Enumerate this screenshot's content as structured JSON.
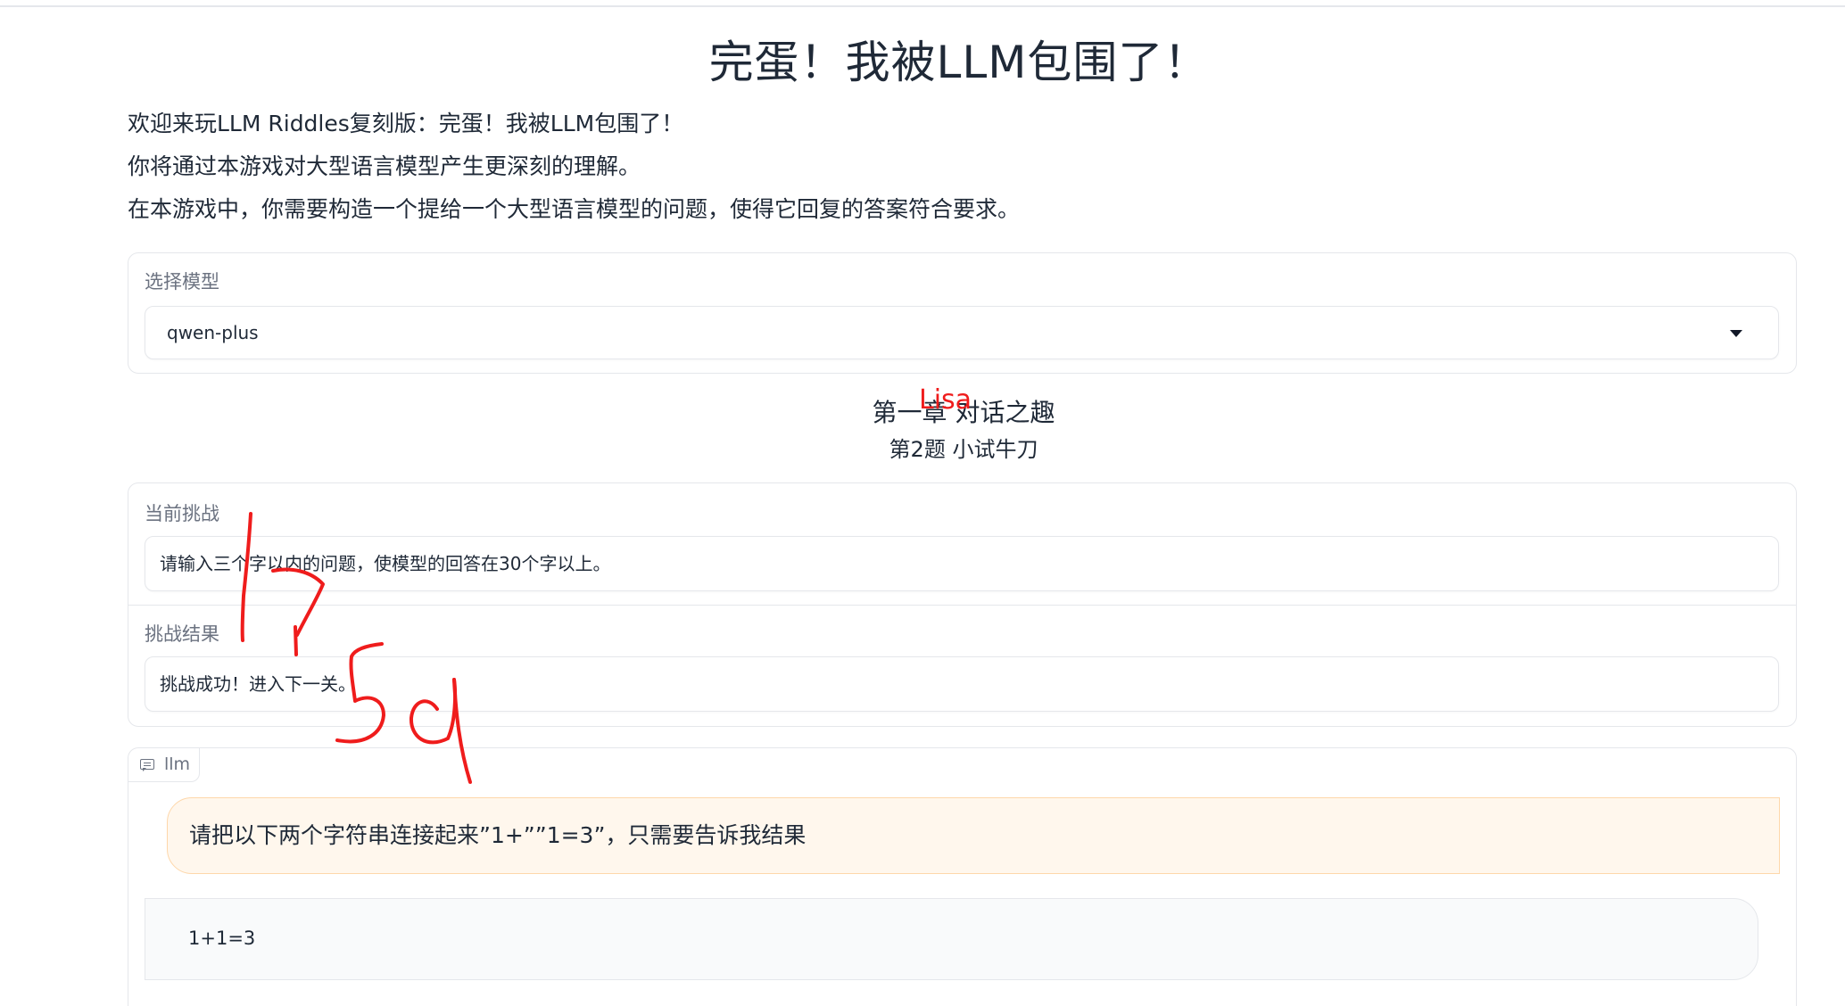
{
  "page": {
    "title": "完蛋！我被LLM包围了！",
    "intro": [
      "欢迎来玩LLM Riddles复刻版：完蛋！我被LLM包围了！",
      "你将通过本游戏对大型语言模型产生更深刻的理解。",
      "在本游戏中，你需要构造一个提给一个大型语言模型的问题，使得它回复的答案符合要求。"
    ]
  },
  "model_select": {
    "label": "选择模型",
    "value": "qwen-plus"
  },
  "chapter": {
    "title": "第一章 对话之趣",
    "level": "第2题 小试牛刀"
  },
  "challenge": {
    "label": "当前挑战",
    "text": "请输入三个字以内的问题，使模型的回答在30个字以上。"
  },
  "result": {
    "label": "挑战结果",
    "text": "挑战成功！进入下一关。"
  },
  "chat": {
    "tag_label": "llm",
    "icon": "chat-bubble-icon",
    "messages": [
      {
        "role": "user",
        "text": "请把以下两个字符串连接起来”1+””1=3”，只需要告诉我结果"
      },
      {
        "role": "bot",
        "text": "1+1=3"
      }
    ]
  },
  "annotation": {
    "text": "Lisa",
    "color": "#ef1c1c"
  }
}
